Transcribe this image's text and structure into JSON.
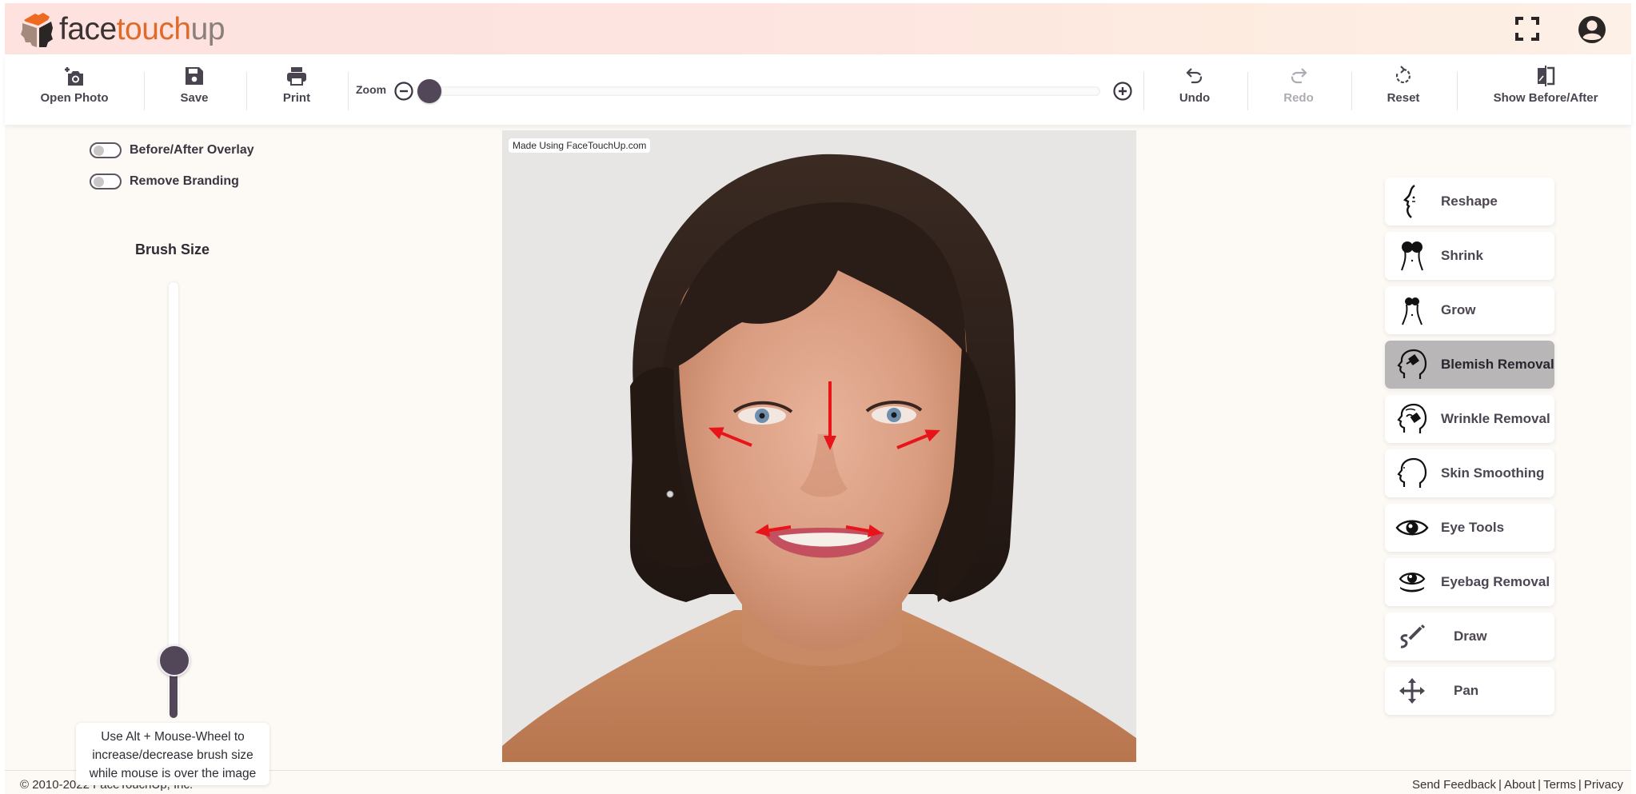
{
  "brand": {
    "name_part1": "face",
    "name_part2": "touch",
    "name_part3": "up",
    "colors": {
      "dark": "#3b3333",
      "orange": "#e06a2a",
      "gray": "#8a7f7b"
    }
  },
  "header": {
    "fullscreen_icon": "fullscreen-icon",
    "account_icon": "account-circle-icon"
  },
  "toolbar": {
    "open_photo": "Open Photo",
    "save": "Save",
    "print": "Print",
    "zoom_label": "Zoom",
    "zoom_value_fraction": 0.0,
    "undo": "Undo",
    "redo": "Redo",
    "redo_disabled": true,
    "reset": "Reset",
    "show_before_after": "Show Before/After"
  },
  "left_panel": {
    "toggles": [
      {
        "label": "Before/After Overlay",
        "on": false
      },
      {
        "label": "Remove Branding",
        "on": false
      }
    ],
    "brush_size_title": "Brush Size",
    "brush_size_fraction": 0.12,
    "tooltip_line1": "Use Alt + Mouse-Wheel to",
    "tooltip_line2": "increase/decrease brush size",
    "tooltip_line3": "while mouse is over the image"
  },
  "canvas": {
    "watermark": "Made Using FaceTouchUp.com",
    "arrow_color": "#e8141a",
    "background_color": "#e7e6e4"
  },
  "tools": [
    {
      "label": "Reshape",
      "icon": "reshape-face-profile-icon",
      "active": false
    },
    {
      "label": "Shrink",
      "icon": "shrink-body-icon",
      "active": false
    },
    {
      "label": "Grow",
      "icon": "grow-body-icon",
      "active": false
    },
    {
      "label": "Blemish Removal",
      "icon": "blemish-removal-head-icon",
      "active": true
    },
    {
      "label": "Wrinkle Removal",
      "icon": "wrinkle-removal-head-icon",
      "active": false
    },
    {
      "label": "Skin Smoothing",
      "icon": "skin-smoothing-head-icon",
      "active": false
    },
    {
      "label": "Eye Tools",
      "icon": "eye-icon",
      "active": false
    },
    {
      "label": "Eyebag Removal",
      "icon": "eyebag-icon",
      "active": false
    },
    {
      "label": "Draw",
      "icon": "draw-pencil-icon",
      "active": false
    },
    {
      "label": "Pan",
      "icon": "pan-arrows-icon",
      "active": false
    }
  ],
  "footer": {
    "copyright": "© 2010-2022 FaceTouchUp, Inc.",
    "links": [
      "Send Feedback",
      "About",
      "Terms",
      "Privacy"
    ]
  }
}
